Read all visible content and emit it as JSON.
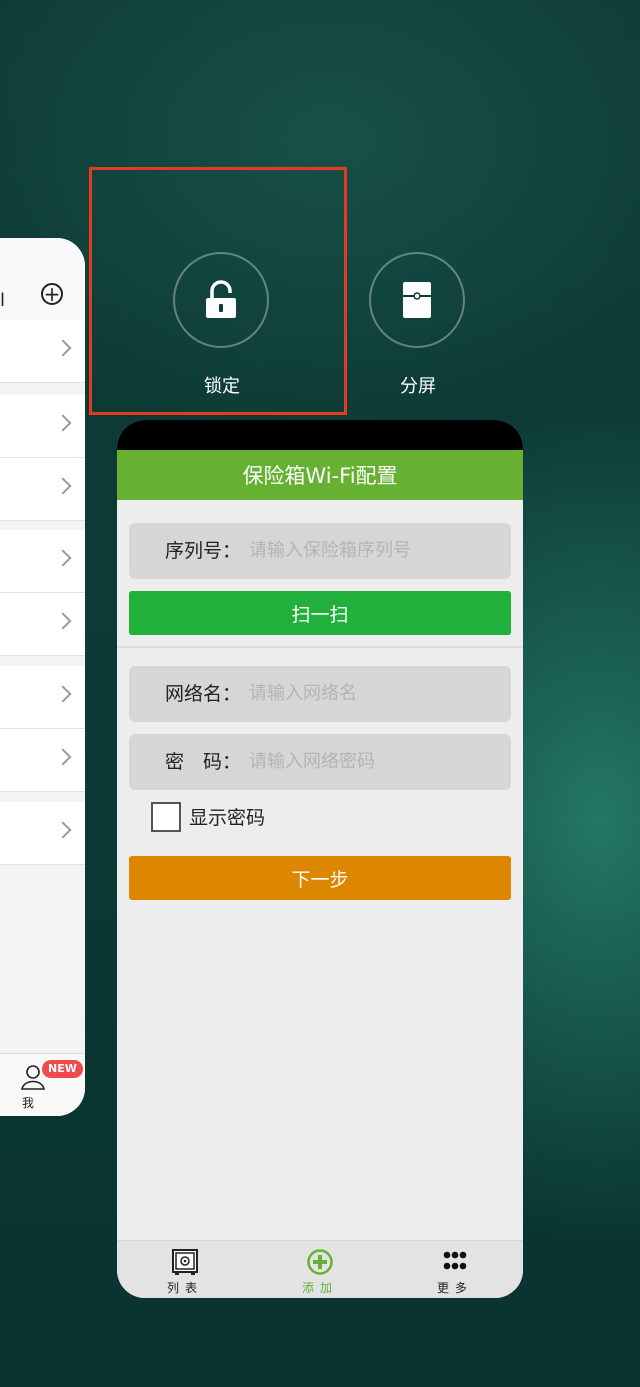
{
  "overlay": {
    "lock_label": "锁定",
    "split_label": "分屏"
  },
  "left_app": {
    "tab_me_label": "我",
    "new_badge": "NEW"
  },
  "app": {
    "title": "保险箱Wi-Fi配置",
    "serial_label": "序列号：",
    "serial_placeholder": "请输入保险箱序列号",
    "scan_button": "扫一扫",
    "network_label": "网络名：",
    "network_placeholder": "请输入网络名",
    "password_label": "密　码：",
    "password_placeholder": "请输入网络密码",
    "show_password": "显示密码",
    "next_button": "下一步",
    "nav": [
      {
        "label": "列表",
        "icon": "safe-icon"
      },
      {
        "label": "添加",
        "icon": "add-circle-icon"
      },
      {
        "label": "更多",
        "icon": "more-dots-icon"
      }
    ]
  },
  "colors": {
    "title_bar": "#66b132",
    "scan_button": "#22b03c",
    "next_button": "#dd8700",
    "active_nav": "#66b132",
    "highlight": "#e23b1e"
  }
}
